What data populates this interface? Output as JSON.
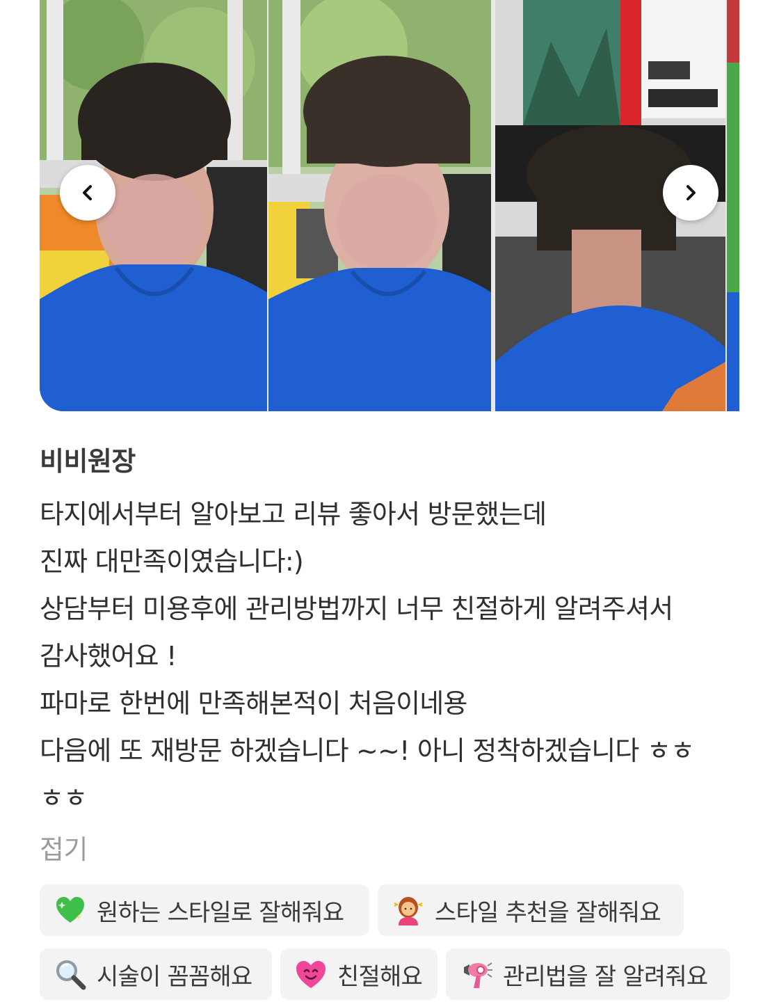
{
  "gallery": {
    "photos": [
      {
        "icon": "perm-front-photo"
      },
      {
        "icon": "perm-front-photo-2"
      },
      {
        "icon": "perm-back-photo"
      }
    ],
    "prev_icon": "chevron-left-icon",
    "next_icon": "chevron-right-icon"
  },
  "review": {
    "author": "비비원장",
    "lines": [
      "타지에서부터 알아보고 리뷰 좋아서 방문했는데",
      "진짜 대만족이였습니다:)",
      "상담부터 미용후에 관리방법까지 너무 친절하게 알려주셔서",
      "감사했어요 !",
      "파마로 한번에 만족해본적이 처음이네용",
      "다음에 또 재방문 하겠습니다 ~~! 아니 정착하겠습니다 ㅎㅎ",
      "ㅎㅎ"
    ],
    "fold_label": "접기"
  },
  "keywords": [
    {
      "icon": "green-heart-icon",
      "label": "원하는 스타일로 잘해줘요"
    },
    {
      "icon": "hairdresser-icon",
      "label": "스타일 추천을 잘해줘요"
    },
    {
      "icon": "magnifier-icon",
      "label": "시술이 꼼꼼해요"
    },
    {
      "icon": "smiling-heart-icon",
      "label": "친절해요"
    },
    {
      "icon": "hair-dryer-icon",
      "label": "관리법을 잘 알려줘요"
    }
  ],
  "colors": {
    "chip_bg": "#f3f3f3",
    "text": "#2f2f2f",
    "muted": "#9c9c9c",
    "shirt_blue": "#1f5fd1"
  }
}
